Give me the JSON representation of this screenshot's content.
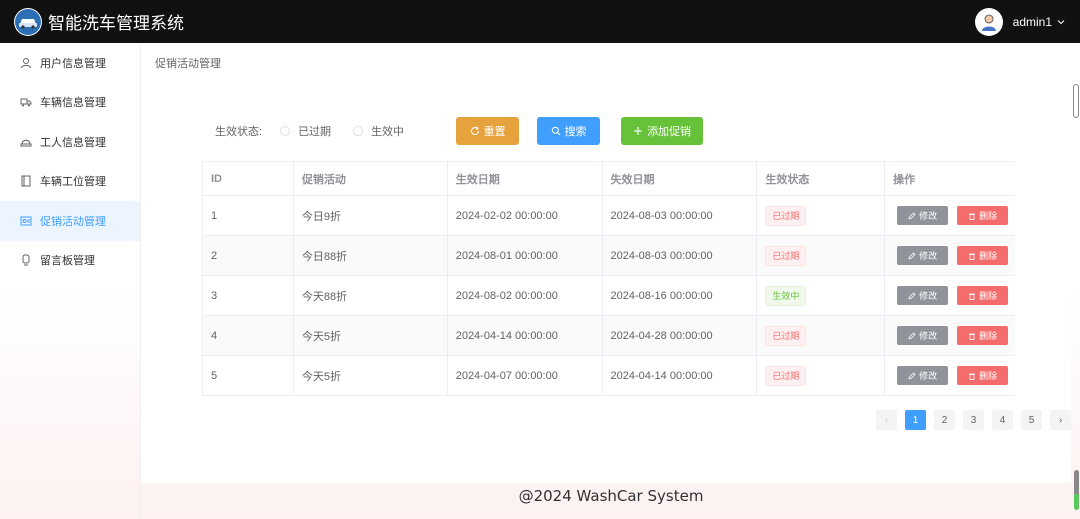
{
  "header": {
    "title": "智能洗车管理系统",
    "user": "admin1"
  },
  "sidebar": {
    "items": [
      {
        "label": "用户信息管理",
        "icon": "user-icon"
      },
      {
        "label": "车辆信息管理",
        "icon": "truck-icon"
      },
      {
        "label": "工人信息管理",
        "icon": "worker-icon"
      },
      {
        "label": "车辆工位管理",
        "icon": "station-icon"
      },
      {
        "label": "促销活动管理",
        "icon": "promotion-icon",
        "active": true
      },
      {
        "label": "留言板管理",
        "icon": "message-icon"
      }
    ]
  },
  "breadcrumb": "促销活动管理",
  "filter": {
    "label": "生效状态:",
    "options": [
      "已过期",
      "生效中"
    ],
    "reset_label": "重置",
    "search_label": "搜索",
    "add_label": "添加促销"
  },
  "table": {
    "headers": [
      "ID",
      "促销活动",
      "生效日期",
      "失效日期",
      "生效状态",
      "操作"
    ],
    "rows": [
      {
        "id": "1",
        "name": "今日9折",
        "start": "2024-02-02 00:00:00",
        "end": "2024-08-03 00:00:00",
        "status": "已过期"
      },
      {
        "id": "2",
        "name": "今日88折",
        "start": "2024-08-01 00:00:00",
        "end": "2024-08-03 00:00:00",
        "status": "已过期"
      },
      {
        "id": "3",
        "name": "今天88折",
        "start": "2024-08-02 00:00:00",
        "end": "2024-08-16 00:00:00",
        "status": "生效中"
      },
      {
        "id": "4",
        "name": "今天5折",
        "start": "2024-04-14 00:00:00",
        "end": "2024-04-28 00:00:00",
        "status": "已过期"
      },
      {
        "id": "5",
        "name": "今天5折",
        "start": "2024-04-07 00:00:00",
        "end": "2024-04-14 00:00:00",
        "status": "已过期"
      }
    ],
    "edit_label": "修改",
    "delete_label": "删除"
  },
  "pagination": {
    "pages": [
      "1",
      "2",
      "3",
      "4",
      "5"
    ],
    "current": "1",
    "prev": "‹",
    "next": "›"
  },
  "footer": "@2024 WashCar System",
  "colors": {
    "header_bg": "#111111",
    "primary": "#409eff",
    "warning": "#e6a23c",
    "success": "#67c23a",
    "danger": "#f56c6c"
  }
}
